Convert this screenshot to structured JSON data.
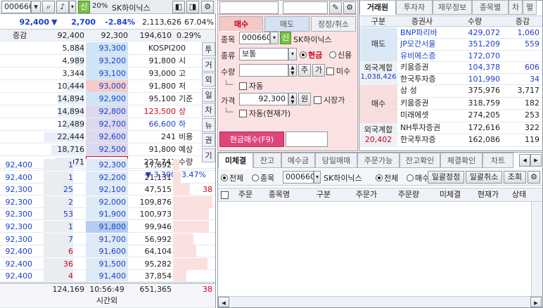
{
  "left": {
    "toolbar": {
      "code": "000660",
      "pct": "20%",
      "name": "SK하이닉스",
      "credit": "신"
    },
    "price_bar": {
      "price": "92,400",
      "arrow": "▼",
      "change": "2,700",
      "rate": "-2.84%",
      "volume": "2,113,626",
      "ratio": "67.04%"
    },
    "header": {
      "label": "증감",
      "ask_price": "92,400",
      "price": "92,300",
      "volume": "194,610",
      "pct": "0.29%"
    },
    "asks": [
      {
        "qty": "5,884",
        "price": "93,300"
      },
      {
        "qty": "4,989",
        "price": "93,200"
      },
      {
        "qty": "3,344",
        "price": "93,100"
      },
      {
        "qty": "10,444",
        "price": "93,000"
      },
      {
        "qty": "14,894",
        "price": "92,900"
      },
      {
        "qty": "14,894",
        "price": "92,800"
      },
      {
        "qty": "12,489",
        "price": "92,700"
      },
      {
        "qty": "22,444",
        "price": "92,600"
      },
      {
        "qty": "18,716",
        "price": "92,500"
      },
      {
        "qty": "16,071",
        "price": "92,400"
      }
    ],
    "info": [
      {
        "val": "KOSPI200",
        "lbl": ""
      },
      {
        "val": "91,800",
        "lbl": "시"
      },
      {
        "val": "93,000",
        "lbl": "고"
      },
      {
        "val": "91,800",
        "lbl": "저"
      },
      {
        "val": "95,100",
        "lbl": "기준"
      },
      {
        "val": "123,500",
        "lbl": "상"
      },
      {
        "val": "66,600",
        "lbl": "하"
      },
      {
        "val": "241",
        "lbl": "비용"
      },
      {
        "val": "91,800",
        "lbl": "예상"
      },
      {
        "val": "227,741",
        "lbl": "수량"
      },
      {
        "val": "▼ 3,300",
        "lbl": "-3.47%"
      }
    ],
    "side_tabs": [
      "투",
      "거",
      "외",
      "일",
      "차",
      "뉴",
      "권",
      "기"
    ],
    "bids": [
      {
        "left": "92,400",
        "cnt": "1",
        "price": "92,300",
        "qty": "17,692",
        "extra": ""
      },
      {
        "left": "92,400",
        "cnt": "1",
        "price": "92,200",
        "qty": "21,131",
        "extra": ""
      },
      {
        "left": "92,300",
        "cnt": "25",
        "price": "92,100",
        "qty": "47,515",
        "extra": "38"
      },
      {
        "left": "92,300",
        "cnt": "2",
        "price": "92,000",
        "qty": "109,876",
        "extra": ""
      },
      {
        "left": "92,300",
        "cnt": "53",
        "price": "91,900",
        "qty": "100,973",
        "extra": ""
      },
      {
        "left": "92,300",
        "cnt": "1",
        "price": "91,800",
        "qty": "99,946",
        "extra": ""
      },
      {
        "left": "92,300",
        "cnt": "7",
        "price": "91,700",
        "qty": "56,992",
        "extra": ""
      },
      {
        "left": "92,400",
        "cnt": "6",
        "price": "91,600",
        "qty": "64,104",
        "extra": ""
      },
      {
        "left": "92,400",
        "cnt": "36",
        "price": "91,500",
        "qty": "95,282",
        "extra": ""
      },
      {
        "left": "92,400",
        "cnt": "4",
        "price": "91,400",
        "qty": "37,854",
        "extra": ""
      }
    ],
    "footer": {
      "ask_total": "124,169",
      "time": "10:56:49",
      "after": "시간외",
      "bid_total": "651,365",
      "extra": "38"
    }
  },
  "order": {
    "tabs": [
      "매수",
      "매도",
      "정정/취소"
    ],
    "code_label": "종목",
    "code": "000660",
    "credit": "신",
    "name": "SK하이닉스",
    "type_label": "종류",
    "type": "보통",
    "cash": "현금",
    "credit_opt": "신용",
    "qty_label": "수량",
    "qty_unit": "주",
    "qty_btn": "가",
    "mi": "미수",
    "auto": "자동",
    "price_label": "가격",
    "price": "92,300",
    "won": "원",
    "market": "시장가",
    "auto_cur": "자동(현재가)",
    "submit": "현금매수(F9)"
  },
  "trader": {
    "tabs": [
      "거래원",
      "투자자",
      "재무정보",
      "종목별",
      "차",
      "펼"
    ],
    "headers": [
      "구분",
      "증권사",
      "수량",
      "증감"
    ],
    "sell_label": "매도",
    "sells": [
      {
        "firm": "BNP파리바",
        "qty": "429,072",
        "chg": "1,060"
      },
      {
        "firm": "JP모간서울",
        "qty": "351,209",
        "chg": "559"
      },
      {
        "firm": "유비에스증",
        "qty": "172,070",
        "chg": ""
      },
      {
        "firm": "키움증권",
        "qty": "104,378",
        "chg": "606"
      },
      {
        "firm": "한국투자증",
        "qty": "101,990",
        "chg": "34"
      }
    ],
    "foreign_sell_label": "외국계합",
    "foreign_sell": "1,038,426",
    "buy_label": "매수",
    "buys": [
      {
        "firm": "삼 성",
        "qty": "375,976",
        "chg": "3,717"
      },
      {
        "firm": "키움증권",
        "qty": "318,759",
        "chg": "182"
      },
      {
        "firm": "미래에셋",
        "qty": "274,205",
        "chg": "253"
      },
      {
        "firm": "NH투자증권",
        "qty": "172,616",
        "chg": "322"
      },
      {
        "firm": "한국투자증",
        "qty": "162,086",
        "chg": "119"
      }
    ],
    "foreign_buy_label": "외국계합",
    "foreign_buy": "20,402"
  },
  "bottom": {
    "tabs": [
      "미체결",
      "잔고",
      "예수금",
      "당일매매",
      "주문가능",
      "잔고확인",
      "체결확인",
      "차트"
    ],
    "filter_all": "전체",
    "filter_stock": "종목",
    "code": "000660",
    "name": "SK하이닉스",
    "f_all": "전체",
    "f_buy": "매수",
    "f_sell": "매도",
    "btn_modify": "일괄정정",
    "btn_cancel": "일괄취소",
    "btn_query": "조회",
    "headers": [
      "주문",
      "종목명",
      "구분",
      "주문가",
      "주문량",
      "미체결",
      "현재가",
      "상태"
    ]
  }
}
